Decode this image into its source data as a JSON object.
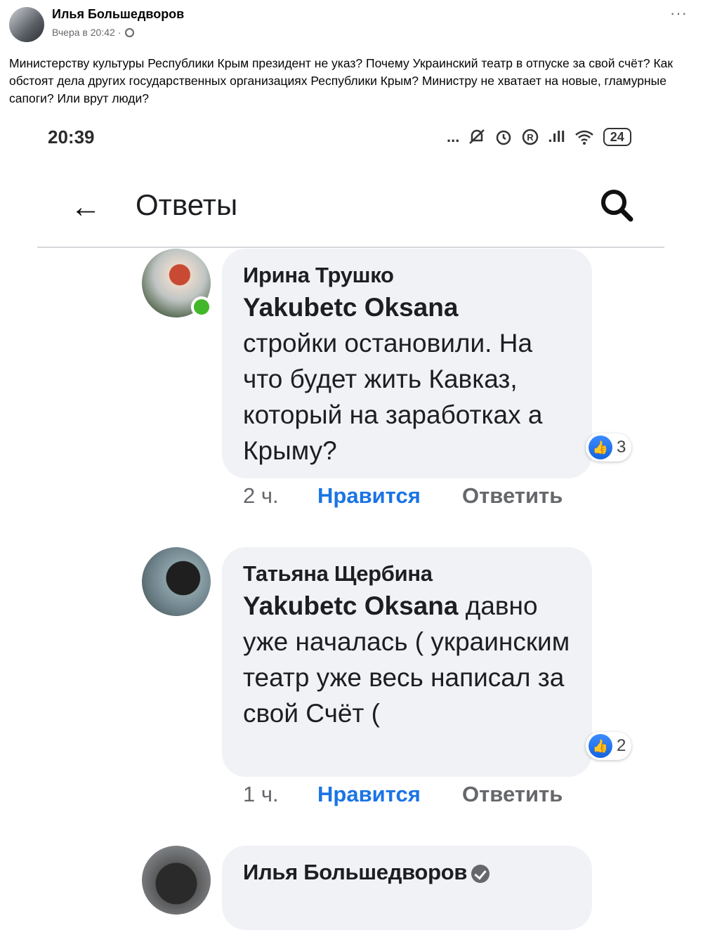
{
  "post": {
    "author": "Илья Большедворов",
    "time": "Вчера в 20:42",
    "separator": "·",
    "more": "···",
    "text": "Министерству культуры Республики Крым президент не указ? Почему Украинский театр в отпуске за свой счёт? Как обстоят дела других государственных организациях Республики Крым? Министру не хватает на новые, гламурные сапоги? Или врут люди?"
  },
  "status_bar": {
    "time": "20:39",
    "dots": "...",
    "signal": ".ıll",
    "battery": "24"
  },
  "appbar": {
    "back": "←",
    "title": "Ответы"
  },
  "comments": [
    {
      "author": "Ирина Трушко",
      "mention": "Yakubetc Oksana",
      "text": "стройки остановили. На что будет жить Кавказ, который на заработках а Крыму?",
      "reactions": "3",
      "time": "2 ч.",
      "like_label": "Нравится",
      "reply_label": "Ответить"
    },
    {
      "author": "Татьяна Щербина",
      "mention": "Yakubetc Oksana",
      "text": "давно уже началась ( украинским театр уже весь написал за свой Счёт (",
      "reactions": "2",
      "time": "1 ч.",
      "like_label": "Нравится",
      "reply_label": "Ответить"
    },
    {
      "author": "Илья Большедворов"
    }
  ]
}
